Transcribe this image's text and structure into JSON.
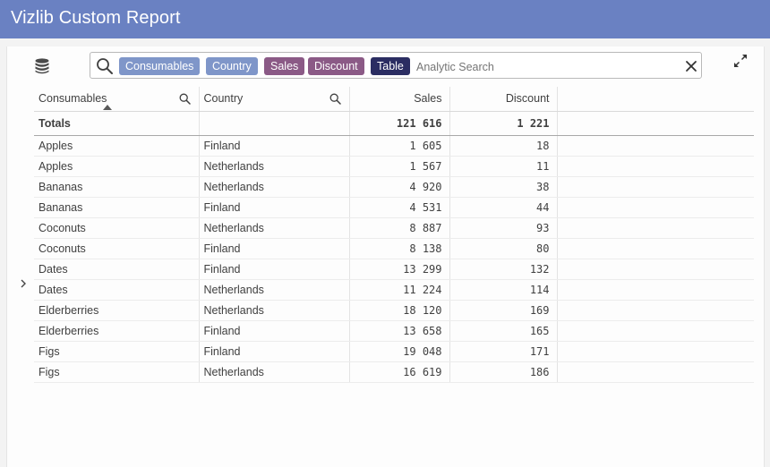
{
  "app": {
    "title": "Vizlib Custom Report"
  },
  "search": {
    "placeholder": "Analytic Search",
    "chips": [
      {
        "label": "Consumables",
        "color": "#7f96c9"
      },
      {
        "label": "Country",
        "color": "#7f96c9"
      },
      {
        "label": "Sales",
        "color": "#8b5a86"
      },
      {
        "label": "Discount",
        "color": "#8b5a86"
      },
      {
        "label": "Table",
        "color": "#2b2d62"
      }
    ]
  },
  "icons": {
    "database": "database-icon",
    "search": "search-icon",
    "clear": "close-icon",
    "expand": "expand-icon",
    "sidebar_toggle": "chevron-right-icon",
    "column_search": "search-icon",
    "sort": "sort-ascending-icon"
  },
  "table": {
    "columns": [
      "Consumables",
      "Country",
      "Sales",
      "Discount"
    ],
    "totals": {
      "label": "Totals",
      "country": "",
      "sales": "121 616",
      "discount": "1 221"
    },
    "rows": [
      {
        "consumable": "Apples",
        "country": "Finland",
        "sales": "1 605",
        "discount": "18"
      },
      {
        "consumable": "Apples",
        "country": "Netherlands",
        "sales": "1 567",
        "discount": "11"
      },
      {
        "consumable": "Bananas",
        "country": "Netherlands",
        "sales": "4 920",
        "discount": "38"
      },
      {
        "consumable": "Bananas",
        "country": "Finland",
        "sales": "4 531",
        "discount": "44"
      },
      {
        "consumable": "Coconuts",
        "country": "Netherlands",
        "sales": "8 887",
        "discount": "93"
      },
      {
        "consumable": "Coconuts",
        "country": "Finland",
        "sales": "8 138",
        "discount": "80"
      },
      {
        "consumable": "Dates",
        "country": "Finland",
        "sales": "13 299",
        "discount": "132"
      },
      {
        "consumable": "Dates",
        "country": "Netherlands",
        "sales": "11 224",
        "discount": "114"
      },
      {
        "consumable": "Elderberries",
        "country": "Netherlands",
        "sales": "18 120",
        "discount": "169"
      },
      {
        "consumable": "Elderberries",
        "country": "Finland",
        "sales": "13 658",
        "discount": "165"
      },
      {
        "consumable": "Figs",
        "country": "Finland",
        "sales": "19 048",
        "discount": "171"
      },
      {
        "consumable": "Figs",
        "country": "Netherlands",
        "sales": "16 619",
        "discount": "186"
      }
    ]
  }
}
